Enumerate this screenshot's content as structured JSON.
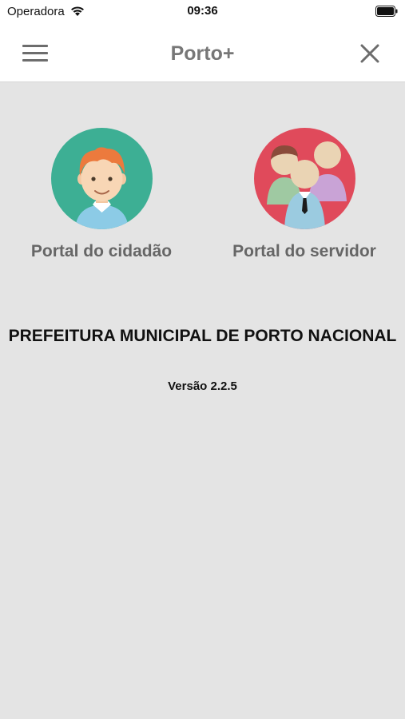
{
  "status": {
    "carrier": "Operadora",
    "time": "09:36"
  },
  "nav": {
    "title": "Porto+",
    "menu_icon": "hamburger-menu-icon",
    "close_icon": "close-icon"
  },
  "portals": [
    {
      "label": "Portal do cidadão",
      "icon": "citizen-avatar-icon",
      "color": "#3daf94"
    },
    {
      "label": "Portal do servidor",
      "icon": "employees-group-icon",
      "color": "#e04a5b"
    }
  ],
  "footer": {
    "organization": "PREFEITURA MUNICIPAL DE PORTO NACIONAL",
    "version": "Versão 2.2.5"
  },
  "colors": {
    "background": "#e4e4e4",
    "nav_background": "#ffffff",
    "title_text": "#777777"
  }
}
